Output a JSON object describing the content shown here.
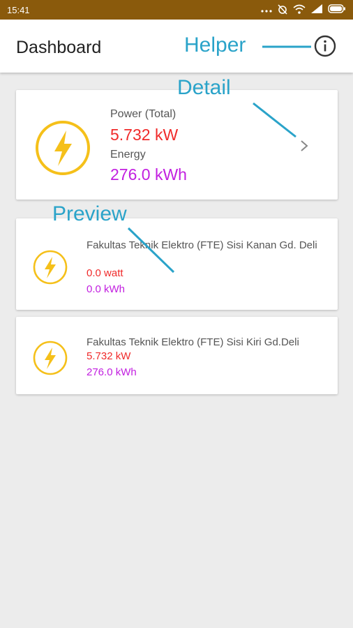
{
  "status_bar": {
    "time": "15:41"
  },
  "app_bar": {
    "title": "Dashboard"
  },
  "summary": {
    "power_label": "Power (Total)",
    "power_value": "5.732 kW",
    "energy_label": "Energy",
    "energy_value": "276.0 kWh"
  },
  "devices": [
    {
      "name": "Fakultas Teknik Elektro (FTE) Sisi Kanan Gd. Deli",
      "power": "0.0 watt",
      "energy": "0.0 kWh"
    },
    {
      "name": "Fakultas Teknik Elektro (FTE) Sisi Kiri Gd.Deli",
      "power": "5.732 kW",
      "energy": "276.0 kWh"
    }
  ],
  "annotations": {
    "helper": "Helper",
    "detail": "Detail",
    "preview": "Preview"
  },
  "colors": {
    "accent": "#f5c01a",
    "power": "#f02a2a",
    "energy": "#c21fe0",
    "annotation": "#2aa3c9",
    "status_bar": "#8a5a0c"
  }
}
